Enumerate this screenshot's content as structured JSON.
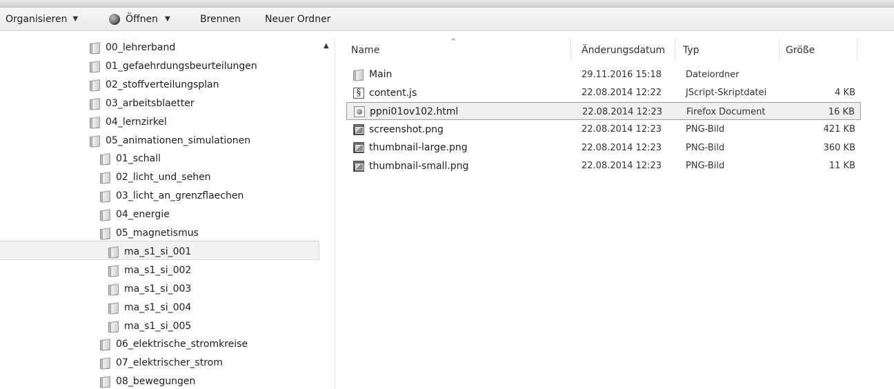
{
  "toolbar": {
    "organize": "Organisieren",
    "open": "Öffnen",
    "burn": "Brennen",
    "new_folder": "Neuer Ordner"
  },
  "nav_tree": [
    "00_lehrerband",
    "01_gefaehrdungsbeurteilungen",
    "02_stoffverteilungsplan",
    "03_arbeitsblaetter",
    "04_lernzirkel",
    "05_animationen_simulationen",
    "01_schall",
    "02_licht_und_sehen",
    "03_licht_an_grenzflaechen",
    "04_energie",
    "05_magnetismus",
    "ma_s1_si_001",
    "ma_s1_si_002",
    "ma_s1_si_003",
    "ma_s1_si_004",
    "ma_s1_si_005",
    "06_elektrische_stromkreise",
    "07_elektrischer_strom",
    "08_bewegungen"
  ],
  "columns": {
    "name": "Name",
    "modified": "Änderungsdatum",
    "type": "Typ",
    "size": "Größe"
  },
  "files": [
    {
      "name": "Main",
      "modified": "29.11.2016 15:18",
      "type": "Dateiordner",
      "size": "",
      "icon": "folder-icon"
    },
    {
      "name": "content.js",
      "modified": "22.08.2014 12:22",
      "type": "JScript-Skriptdatei",
      "size": "4 KB",
      "icon": "script-file-icon"
    },
    {
      "name": "ppni01ov102.html",
      "modified": "22.08.2014 12:23",
      "type": "Firefox Document",
      "size": "16 KB",
      "icon": "html-file-icon"
    },
    {
      "name": "screenshot.png",
      "modified": "22.08.2014 12:23",
      "type": "PNG-Bild",
      "size": "421 KB",
      "icon": "image-file-icon"
    },
    {
      "name": "thumbnail-large.png",
      "modified": "22.08.2014 12:23",
      "type": "PNG-Bild",
      "size": "360 KB",
      "icon": "image-file-icon"
    },
    {
      "name": "thumbnail-small.png",
      "modified": "22.08.2014 12:23",
      "type": "PNG-Bild",
      "size": "11 KB",
      "icon": "image-file-icon"
    }
  ]
}
